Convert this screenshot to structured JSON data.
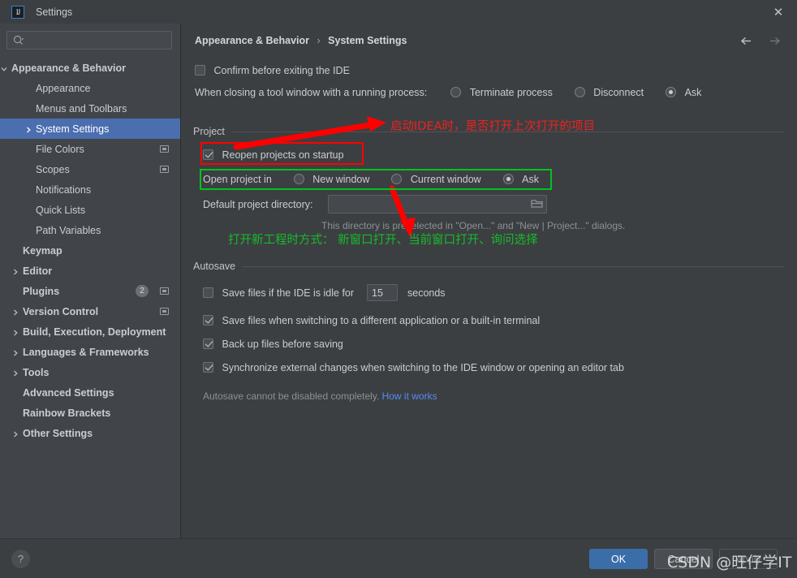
{
  "window": {
    "title": "Settings",
    "app_icon": "intellij-idea-icon",
    "close_icon": "close-icon"
  },
  "sidebar": {
    "search": {
      "placeholder": "",
      "value": "",
      "icon": "search-icon"
    },
    "items": [
      {
        "label": "Appearance & Behavior",
        "indent": 14,
        "bold": true,
        "arrow": "chevron-down",
        "selected": false
      },
      {
        "label": "Appearance",
        "indent": 44,
        "bold": false,
        "arrow": "none",
        "selected": false
      },
      {
        "label": "Menus and Toolbars",
        "indent": 44,
        "bold": false,
        "arrow": "none",
        "selected": false
      },
      {
        "label": "System Settings",
        "indent": 44,
        "bold": false,
        "arrow": "chevron-right",
        "selected": true
      },
      {
        "label": "File Colors",
        "indent": 44,
        "bold": false,
        "arrow": "none",
        "selected": false,
        "project_icon": true
      },
      {
        "label": "Scopes",
        "indent": 44,
        "bold": false,
        "arrow": "none",
        "selected": false,
        "project_icon": true
      },
      {
        "label": "Notifications",
        "indent": 44,
        "bold": false,
        "arrow": "none",
        "selected": false
      },
      {
        "label": "Quick Lists",
        "indent": 44,
        "bold": false,
        "arrow": "none",
        "selected": false
      },
      {
        "label": "Path Variables",
        "indent": 44,
        "bold": false,
        "arrow": "none",
        "selected": false
      },
      {
        "label": "Keymap",
        "indent": 28,
        "bold": true,
        "arrow": "none",
        "selected": false
      },
      {
        "label": "Editor",
        "indent": 28,
        "bold": true,
        "arrow": "chevron-right",
        "selected": false
      },
      {
        "label": "Plugins",
        "indent": 28,
        "bold": true,
        "arrow": "none",
        "selected": false,
        "badge": "2",
        "project_icon": true
      },
      {
        "label": "Version Control",
        "indent": 28,
        "bold": true,
        "arrow": "chevron-right",
        "selected": false,
        "project_icon": true
      },
      {
        "label": "Build, Execution, Deployment",
        "indent": 28,
        "bold": true,
        "arrow": "chevron-right",
        "selected": false
      },
      {
        "label": "Languages & Frameworks",
        "indent": 28,
        "bold": true,
        "arrow": "chevron-right",
        "selected": false
      },
      {
        "label": "Tools",
        "indent": 28,
        "bold": true,
        "arrow": "chevron-right",
        "selected": false
      },
      {
        "label": "Advanced Settings",
        "indent": 28,
        "bold": true,
        "arrow": "none",
        "selected": false
      },
      {
        "label": "Rainbow Brackets",
        "indent": 28,
        "bold": true,
        "arrow": "none",
        "selected": false
      },
      {
        "label": "Other Settings",
        "indent": 28,
        "bold": true,
        "arrow": "chevron-right",
        "selected": false
      }
    ]
  },
  "main": {
    "breadcrumb": {
      "parent": "Appearance & Behavior",
      "separator": "›",
      "current": "System Settings"
    },
    "nav": {
      "back_icon": "arrow-left-icon",
      "forward_icon": "arrow-right-icon"
    },
    "confirm_exit": {
      "label": "Confirm before exiting the IDE",
      "checked": false
    },
    "tool_window": {
      "label": "When closing a tool window with a running process:",
      "options": [
        {
          "label": "Terminate process",
          "selected": false
        },
        {
          "label": "Disconnect",
          "selected": false
        },
        {
          "label": "Ask",
          "selected": true
        }
      ]
    },
    "project_group": {
      "title": "Project",
      "reopen": {
        "label": "Reopen projects on startup",
        "checked": true
      },
      "open_project_in": {
        "label": "Open project in",
        "options": [
          {
            "label": "New window",
            "selected": false
          },
          {
            "label": "Current window",
            "selected": false
          },
          {
            "label": "Ask",
            "selected": true
          }
        ]
      },
      "default_dir": {
        "label": "Default project directory:",
        "value": "",
        "browse_icon": "folder-icon",
        "hint": "This directory is preselected in \"Open...\" and \"New | Project...\" dialogs."
      }
    },
    "autosave_group": {
      "title": "Autosave",
      "idle": {
        "label_before": "Save files if the IDE is idle for",
        "value": "15",
        "label_after": "seconds",
        "checked": false
      },
      "checkboxes": [
        {
          "label": "Save files when switching to a different application or a built-in terminal",
          "checked": true
        },
        {
          "label": "Back up files before saving",
          "checked": true
        },
        {
          "label": "Synchronize external changes when switching to the IDE window or opening an editor tab",
          "checked": true
        }
      ],
      "note": "Autosave cannot be disabled completely.",
      "note_link": "How it works"
    }
  },
  "footer": {
    "help_icon": "question-mark-icon",
    "ok_label": "OK",
    "cancel_label": "Cancel",
    "apply_label": "Apply"
  },
  "annotations": {
    "red_note_top": "启动IDEA时，是否打开上次打开的项目",
    "green_note_bottom": "打开新工程时方式： 新窗口打开、当前窗口打开、询问选择",
    "red_box_target": "reopen-projects-on-startup",
    "green_box_target": "open-project-in",
    "colors": {
      "red": "#ff0000",
      "green": "#00c220"
    }
  },
  "watermark": {
    "text": "CSDN @旺仔学IT"
  }
}
